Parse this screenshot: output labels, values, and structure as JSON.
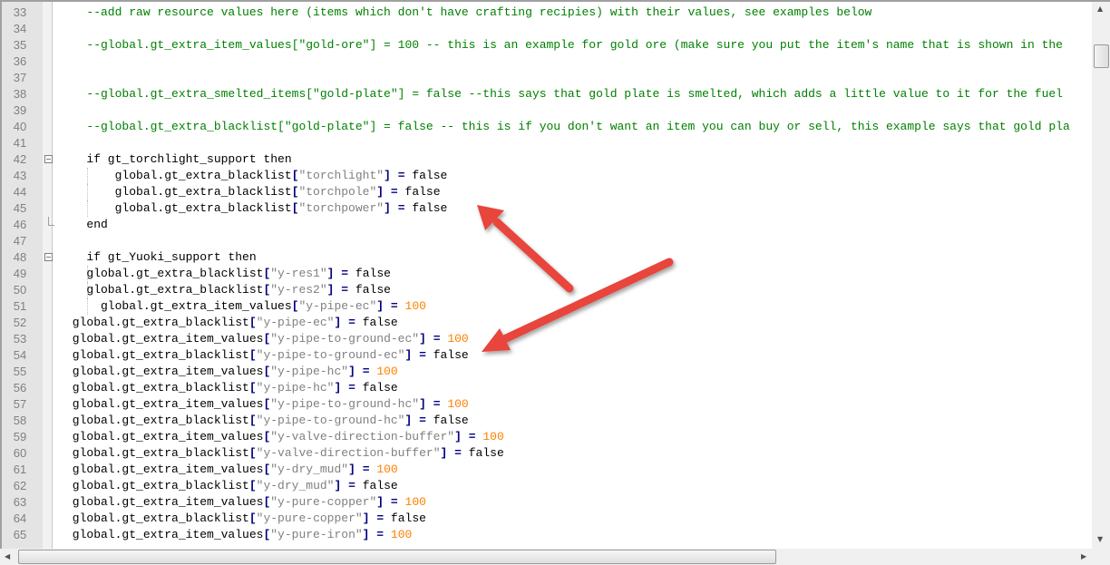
{
  "editor": {
    "lines": [
      {
        "n": "33",
        "text": "   --add raw resource values here (items which don't have crafting recipies) with their values, see examples below"
      },
      {
        "n": "34",
        "text": ""
      },
      {
        "n": "35",
        "text": "   --global.gt_extra_item_values[\"gold-ore\"] = 100 -- this is an example for gold ore (make sure you put the item's name that is shown in the"
      },
      {
        "n": "36",
        "text": ""
      },
      {
        "n": "37",
        "text": ""
      },
      {
        "n": "38",
        "text": "   --global.gt_extra_smelted_items[\"gold-plate\"] = false --this says that gold plate is smelted, which adds a little value to it for the fuel"
      },
      {
        "n": "39",
        "text": ""
      },
      {
        "n": "40",
        "text": "   --global.gt_extra_blacklist[\"gold-plate\"] = false -- this is if you don't want an item you can buy or sell, this example says that gold pla"
      },
      {
        "n": "41",
        "text": ""
      },
      {
        "n": "42",
        "text": "   if gt_torchlight_support then",
        "fold": "open"
      },
      {
        "n": "43",
        "text": "       global.gt_extra_blacklist[\"torchlight\"] = false",
        "guide": true
      },
      {
        "n": "44",
        "text": "       global.gt_extra_blacklist[\"torchpole\"] = false",
        "guide": true
      },
      {
        "n": "45",
        "text": "       global.gt_extra_blacklist[\"torchpower\"] = false",
        "guide": true
      },
      {
        "n": "46",
        "text": "   end",
        "fold": "end"
      },
      {
        "n": "47",
        "text": ""
      },
      {
        "n": "48",
        "text": "   if gt_Yuoki_support then",
        "fold": "open"
      },
      {
        "n": "49",
        "text": "   global.gt_extra_blacklist[\"y-res1\"] = false",
        "guide": true
      },
      {
        "n": "50",
        "text": "   global.gt_extra_blacklist[\"y-res2\"] = false",
        "guide": true
      },
      {
        "n": "51",
        "text": "     global.gt_extra_item_values[\"y-pipe-ec\"] = 100",
        "guide": true
      },
      {
        "n": "52",
        "text": " global.gt_extra_blacklist[\"y-pipe-ec\"] = false"
      },
      {
        "n": "53",
        "text": " global.gt_extra_item_values[\"y-pipe-to-ground-ec\"] = 100"
      },
      {
        "n": "54",
        "text": " global.gt_extra_blacklist[\"y-pipe-to-ground-ec\"] = false"
      },
      {
        "n": "55",
        "text": " global.gt_extra_item_values[\"y-pipe-hc\"] = 100"
      },
      {
        "n": "56",
        "text": " global.gt_extra_blacklist[\"y-pipe-hc\"] = false"
      },
      {
        "n": "57",
        "text": " global.gt_extra_item_values[\"y-pipe-to-ground-hc\"] = 100"
      },
      {
        "n": "58",
        "text": " global.gt_extra_blacklist[\"y-pipe-to-ground-hc\"] = false"
      },
      {
        "n": "59",
        "text": " global.gt_extra_item_values[\"y-valve-direction-buffer\"] = 100"
      },
      {
        "n": "60",
        "text": " global.gt_extra_blacklist[\"y-valve-direction-buffer\"] = false"
      },
      {
        "n": "61",
        "text": " global.gt_extra_item_values[\"y-dry_mud\"] = 100"
      },
      {
        "n": "62",
        "text": " global.gt_extra_blacklist[\"y-dry_mud\"] = false"
      },
      {
        "n": "63",
        "text": " global.gt_extra_item_values[\"y-pure-copper\"] = 100"
      },
      {
        "n": "64",
        "text": " global.gt_extra_blacklist[\"y-pure-copper\"] = false"
      },
      {
        "n": "65",
        "text": " global.gt_extra_item_values[\"y-pure-iron\"] = 100"
      }
    ]
  },
  "colors": {
    "comment": "#008000",
    "keyword": "#0000ff",
    "string": "#808080",
    "operator": "#000080",
    "number": "#ff8000",
    "annotation_arrow": "#e8453c"
  },
  "icons": {
    "scroll_up": "▲",
    "scroll_down": "▼",
    "scroll_left": "◀",
    "scroll_right": "▶"
  }
}
